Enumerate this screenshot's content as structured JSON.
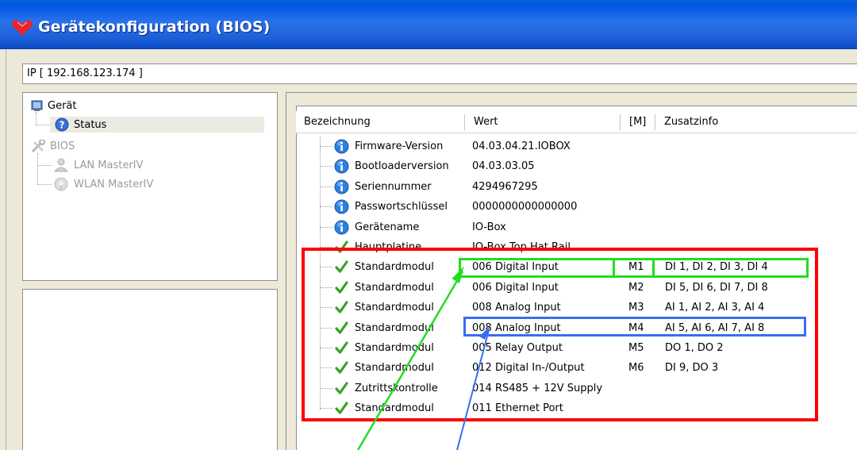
{
  "window": {
    "title": "Gerätekonfiguration (BIOS)",
    "logo_icon": "red-heart-logo-icon"
  },
  "ip_field": {
    "value": "IP [ 192.168.123.174 ]"
  },
  "tree": {
    "items": [
      {
        "label": "Gerät",
        "icon": "device-icon",
        "disabled": false
      },
      {
        "label": "Status",
        "icon": "help-icon",
        "disabled": false,
        "selected": true
      },
      {
        "label": "BIOS",
        "icon": "tools-icon",
        "disabled": true
      },
      {
        "label": "LAN MasterIV",
        "icon": "network-user-icon",
        "disabled": true
      },
      {
        "label": "WLAN MasterIV",
        "icon": "wireless-icon",
        "disabled": true
      }
    ]
  },
  "table": {
    "headers": {
      "bezeichnung": "Bezeichnung",
      "wert": "Wert",
      "m": "[M]",
      "zusatz": "Zusatzinfo"
    },
    "rows": [
      {
        "icon": "info-icon",
        "bezeichnung": "Firmware-Version",
        "wert": "04.03.04.21.IOBOX",
        "m": "",
        "zusatz": ""
      },
      {
        "icon": "info-icon",
        "bezeichnung": "Bootloaderversion",
        "wert": "04.03.03.05",
        "m": "",
        "zusatz": ""
      },
      {
        "icon": "info-icon",
        "bezeichnung": "Seriennummer",
        "wert": "4294967295",
        "m": "",
        "zusatz": ""
      },
      {
        "icon": "info-icon",
        "bezeichnung": "Passwortschlüssel",
        "wert": "0000000000000000",
        "m": "",
        "zusatz": ""
      },
      {
        "icon": "info-icon",
        "bezeichnung": "Gerätename",
        "wert": "IO-Box",
        "m": "",
        "zusatz": ""
      },
      {
        "icon": "check-icon",
        "bezeichnung": "Hauptplatine",
        "wert": "IO-Box Top Hat Rail",
        "m": "",
        "zusatz": ""
      },
      {
        "icon": "check-icon",
        "bezeichnung": "Standardmodul",
        "wert": "006 Digital Input",
        "m": "M1",
        "zusatz": "DI 1, DI 2, DI 3, DI 4"
      },
      {
        "icon": "check-icon",
        "bezeichnung": "Standardmodul",
        "wert": "006 Digital Input",
        "m": "M2",
        "zusatz": "DI 5, DI 6, DI 7, DI 8"
      },
      {
        "icon": "check-icon",
        "bezeichnung": "Standardmodul",
        "wert": "008 Analog Input",
        "m": "M3",
        "zusatz": "AI 1, AI 2, AI 3, AI 4"
      },
      {
        "icon": "check-icon",
        "bezeichnung": "Standardmodul",
        "wert": "008 Analog Input",
        "m": "M4",
        "zusatz": "AI 5, AI 6, AI 7, AI 8"
      },
      {
        "icon": "check-icon",
        "bezeichnung": "Standardmodul",
        "wert": "005 Relay Output",
        "m": "M5",
        "zusatz": "DO 1, DO 2"
      },
      {
        "icon": "check-icon",
        "bezeichnung": "Standardmodul",
        "wert": "012 Digital In-/Output",
        "m": "M6",
        "zusatz": "DI 9, DO 3"
      },
      {
        "icon": "check-icon",
        "bezeichnung": "Zutrittskontrolle",
        "wert": "014 RS485 + 12V Supply",
        "m": "",
        "zusatz": ""
      },
      {
        "icon": "check-icon",
        "bezeichnung": "Standardmodul",
        "wert": "011 Ethernet Port",
        "m": "",
        "zusatz": ""
      }
    ]
  },
  "annotations": {
    "red_box_color": "#ff0000",
    "green_box_color": "#22dd22",
    "blue_box_color": "#3a6df0"
  }
}
